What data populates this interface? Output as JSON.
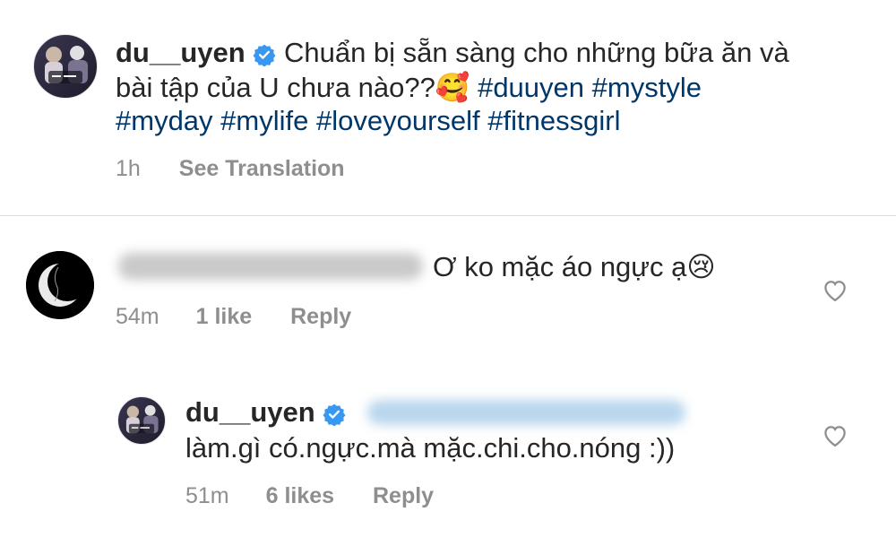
{
  "post": {
    "username": "du__uyen",
    "caption_text": "Chuẩn bị sẵn sàng cho những bữa ăn và",
    "caption_line2": "bài tập của U chưa nào??",
    "emoji_smile_hearts": "🥰",
    "hashtags_line2": [
      "#duuyen",
      "#mystyle"
    ],
    "hashtags_line3": [
      "#myday",
      "#mylife",
      "#loveyourself",
      "#fitnessgirl"
    ],
    "time": "1h",
    "see_translation": "See Translation"
  },
  "comment1": {
    "text": "Ơ ko mặc áo ngực ạ",
    "emoji": "😢",
    "time": "54m",
    "likes": "1 like",
    "reply": "Reply"
  },
  "reply1": {
    "username": "du__uyen",
    "text": "làm.gì có.ngực.mà mặc.chi.cho.nóng :))",
    "time": "51m",
    "likes": "6 likes",
    "reply": "Reply"
  },
  "colors": {
    "hashtag": "#00376b",
    "verified": "#3897f0",
    "meta": "#8e8e8e"
  }
}
